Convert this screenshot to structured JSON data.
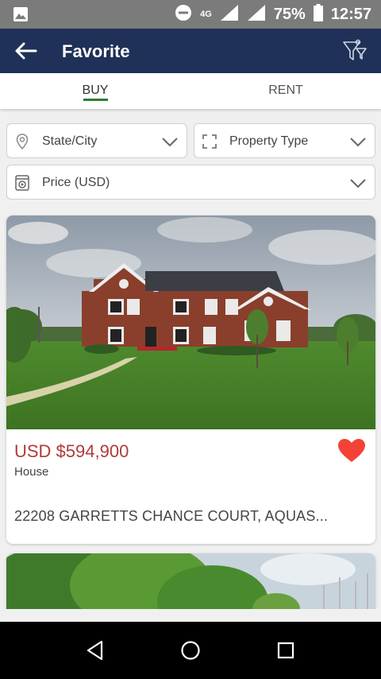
{
  "status_bar": {
    "network": "4G",
    "battery": "75%",
    "time": "12:57"
  },
  "app_bar": {
    "title": "Favorite",
    "back_icon": "arrow-left-icon",
    "filter_icon": "filter-icon"
  },
  "tabs": [
    {
      "label": "BUY",
      "active": true
    },
    {
      "label": "RENT",
      "active": false
    }
  ],
  "filters": {
    "state_city": {
      "label": "State/City",
      "icon": "location-pin-icon"
    },
    "property_type": {
      "label": "Property Type",
      "icon": "expand-icon"
    },
    "price": {
      "label": "Price (USD)",
      "icon": "price-tag-icon"
    }
  },
  "listings": [
    {
      "price": "USD $594,900",
      "type": "House",
      "address": "22208 GARRETTS CHANCE COURT, AQUAS...",
      "favorite": true
    }
  ],
  "colors": {
    "app_bar": "#1f3158",
    "price": "#b03a3a",
    "heart": "#f44336",
    "tab_indicator": "#2e7d32"
  }
}
